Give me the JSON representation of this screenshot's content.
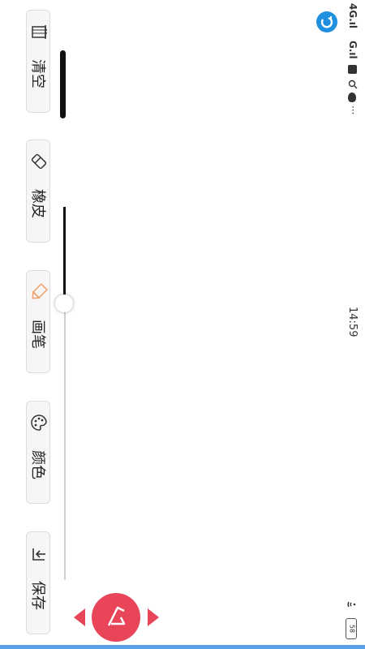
{
  "toolbar": {
    "clear_label": "清空",
    "eraser_label": "橡皮",
    "pen_label": "画笔",
    "color_label": "颜色",
    "save_label": "保存"
  },
  "status_bar": {
    "time": "14:59",
    "signal_left": "4G.ıl",
    "signal_right": "G.ıl",
    "battery": "58"
  },
  "pen_size": {
    "value_fraction": 0.35
  },
  "colors": {
    "accent": "#e84559",
    "app_blue": "#1f8fe0",
    "stroke": "#111111"
  }
}
